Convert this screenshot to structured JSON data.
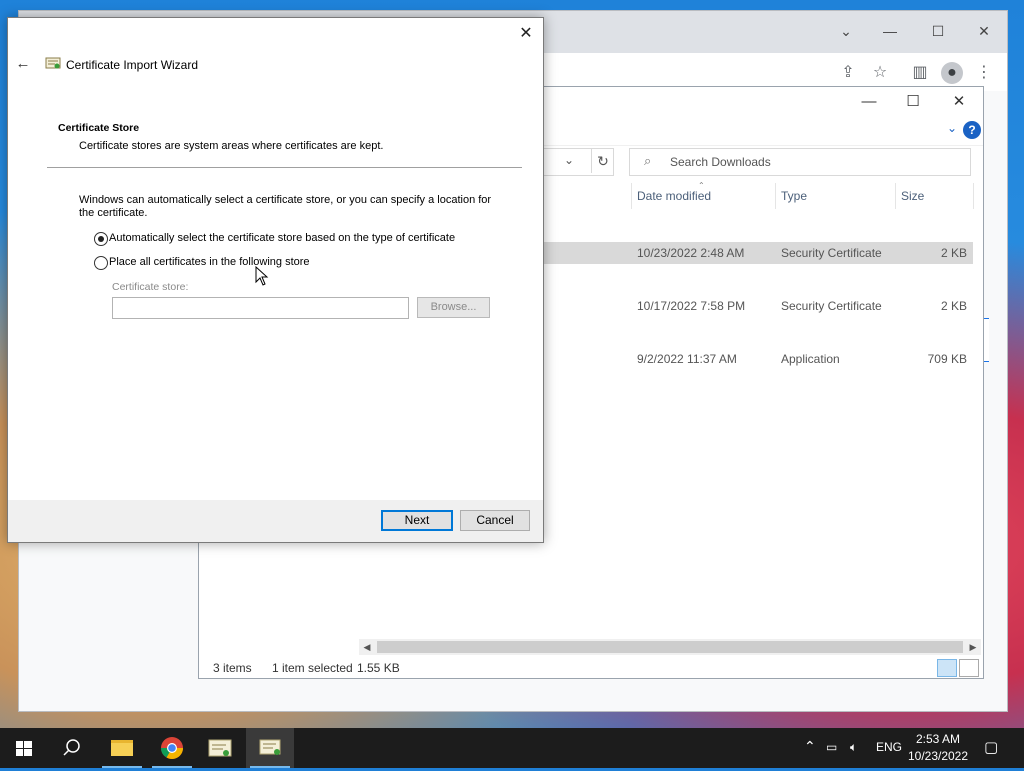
{
  "wizard": {
    "title": "Certificate Import Wizard",
    "section_heading": "Certificate Store",
    "section_description": "Certificate stores are system areas where certificates are kept.",
    "intro_text": "Windows can automatically select a certificate store, or you can specify a location for the certificate.",
    "option_auto": "Automatically select the certificate store based on the type of certificate",
    "option_place": "Place all certificates in the following store",
    "selected_option": "auto",
    "store_label": "Certificate store:",
    "store_value": "",
    "browse_label": "Browse...",
    "next_label": "Next",
    "cancel_label": "Cancel"
  },
  "explorer": {
    "search_placeholder": "Search Downloads",
    "columns": [
      "Date modified",
      "Type",
      "Size"
    ],
    "rows": [
      {
        "date": "10/23/2022 2:48 AM",
        "type": "Security Certificate",
        "size": "2 KB",
        "selected": true
      },
      {
        "date": "10/17/2022 7:58 PM",
        "type": "Security Certificate",
        "size": "2 KB",
        "selected": false
      },
      {
        "date": "9/2/2022 11:37 AM",
        "type": "Application",
        "size": "709 KB",
        "selected": false
      }
    ],
    "status_items": "3 items",
    "status_selected": "1 item selected",
    "status_size": "1.55 KB"
  },
  "taskbar": {
    "language": "ENG",
    "time": "2:53 AM",
    "date": "10/23/2022"
  },
  "colors": {
    "accent": "#0078d7",
    "taskbar": "#1c1c1c",
    "selected_row": "#d9d9d9",
    "help_icon": "#1a62c4"
  }
}
